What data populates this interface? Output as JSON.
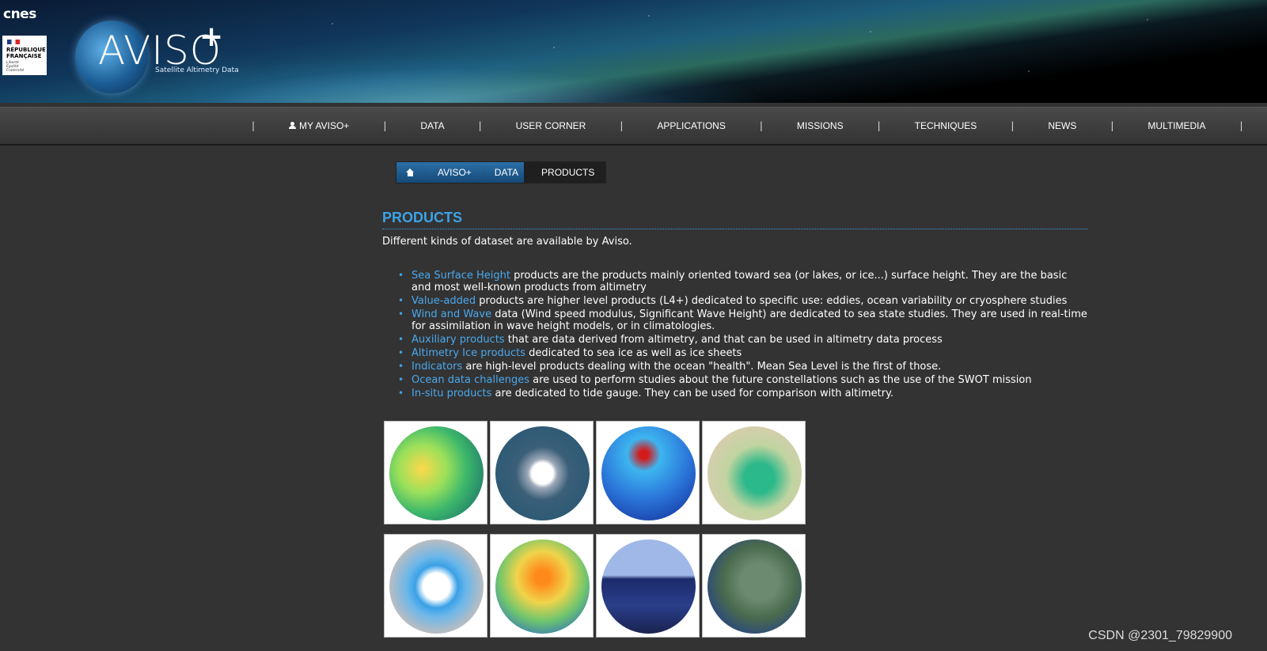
{
  "header": {
    "cnes_logo": "cnes",
    "rf_lines": [
      "RÉPUBLIQUE",
      "FRANÇAISE"
    ],
    "rf_motto": [
      "Liberté",
      "Égalité",
      "Fraternité"
    ],
    "logo_text": "AVISO",
    "logo_plus": "+",
    "logo_subtitle": "Satellite Altimetry Data"
  },
  "nav": {
    "separator": "|",
    "items": [
      {
        "label": "MY AVISO+",
        "icon": "user-icon"
      },
      {
        "label": "DATA"
      },
      {
        "label": "USER CORNER"
      },
      {
        "label": "APPLICATIONS"
      },
      {
        "label": "MISSIONS"
      },
      {
        "label": "TECHNIQUES"
      },
      {
        "label": "NEWS"
      },
      {
        "label": "MULTIMEDIA"
      }
    ]
  },
  "breadcrumb": {
    "home_icon": "home-icon",
    "items": [
      "AVISO+",
      "DATA",
      "PRODUCTS"
    ]
  },
  "main": {
    "title": "PRODUCTS",
    "intro": "Different kinds of dataset are available by Aviso.",
    "products": [
      {
        "link": "Sea Surface Height",
        "text": " products are the products mainly oriented toward sea (or lakes, or ice...) surface height. They are the basic and most well-known products from altimetry"
      },
      {
        "link": "Value-added",
        "text": " products are higher level products (L4+) dedicated to specific use: eddies, ocean variability or cryosphere studies"
      },
      {
        "link": "Wind and Wave",
        "text": " data (Wind speed modulus, Significant Wave Height) are dedicated to sea state studies. They are used in real-time for assimilation in wave height models, or in climatologies."
      },
      {
        "link": "Auxiliary products",
        "text": " that are data derived from altimetry, and that can be used in altimetry data process"
      },
      {
        "link": "Altimetry Ice products",
        "text": " dedicated to sea ice as well as ice sheets"
      },
      {
        "link": "Indicators",
        "text": " are high-level products dealing with the ocean \"health\". Mean Sea Level is the first of those."
      },
      {
        "link": "Ocean data challenges",
        "text": " are used to perform studies about the future constellations such as the use of the SWOT mission"
      },
      {
        "link": "In-situ products",
        "text": "  are dedicated to tide gauge. They can be used for comparison with altimetry."
      }
    ]
  },
  "watermark": "CSDN @2301_79829900"
}
